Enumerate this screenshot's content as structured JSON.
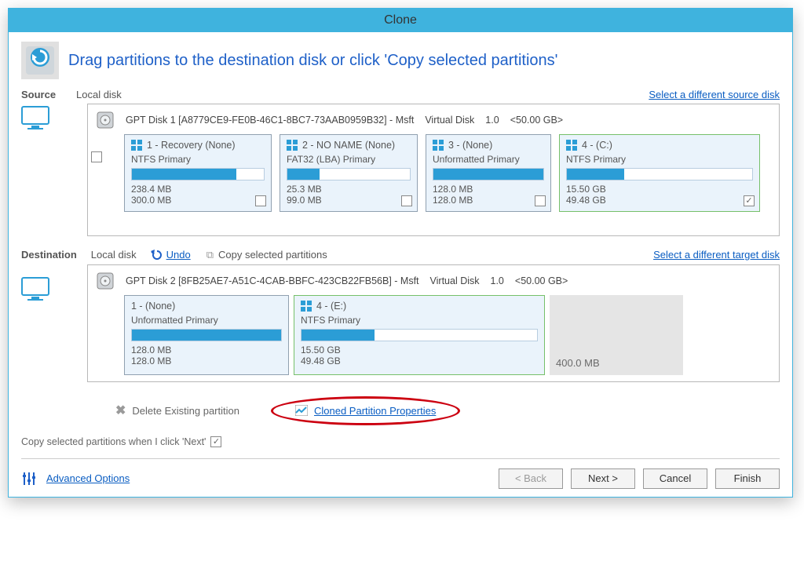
{
  "title": "Clone",
  "header": "Drag partitions to the destination disk or click 'Copy selected partitions'",
  "source": {
    "label": "Source",
    "disk_type": "Local disk",
    "different_link": "Select a different source disk",
    "disk_id": "GPT Disk 1 [A8779CE9-FE0B-46C1-8BC7-73AAB0959B32] - Msft",
    "disk_kind": "Virtual Disk",
    "disk_ver": "1.0",
    "disk_size": "<50.00 GB>",
    "partitions": [
      {
        "title": "1 - Recovery (None)",
        "sub": "NTFS Primary",
        "used": "238.4 MB",
        "total": "300.0 MB",
        "fill": 79,
        "checked": false,
        "sel": false
      },
      {
        "title": "2 - NO NAME (None)",
        "sub": "FAT32 (LBA) Primary",
        "used": "25.3 MB",
        "total": "99.0 MB",
        "fill": 26,
        "checked": false,
        "sel": false
      },
      {
        "title": "3 -  (None)",
        "sub": "Unformatted Primary",
        "used": "128.0 MB",
        "total": "128.0 MB",
        "fill": 100,
        "checked": false,
        "sel": false
      },
      {
        "title": "4 -  (C:)",
        "sub": "NTFS Primary",
        "used": "15.50 GB",
        "total": "49.48 GB",
        "fill": 31,
        "checked": true,
        "sel": true
      }
    ]
  },
  "dest": {
    "label": "Destination",
    "disk_type": "Local disk",
    "undo": "Undo",
    "copy_sel": "Copy selected partitions",
    "different_link": "Select a different target disk",
    "disk_id": "GPT Disk 2 [8FB25AE7-A51C-4CAB-BBFC-423CB22FB56B] - Msft",
    "disk_kind": "Virtual Disk",
    "disk_ver": "1.0",
    "disk_size": "<50.00 GB>",
    "partitions": [
      {
        "title": "1 -  (None)",
        "sub": "Unformatted Primary",
        "used": "128.0 MB",
        "total": "128.0 MB",
        "fill": 100,
        "sel": false
      },
      {
        "title": "4 -  (E:)",
        "sub": "NTFS Primary",
        "used": "15.50 GB",
        "total": "49.48 GB",
        "fill": 31,
        "sel": true
      }
    ],
    "free": "400.0 MB"
  },
  "actions": {
    "delete": "Delete Existing partition",
    "props": "Cloned Partition Properties",
    "copy_next": "Copy selected partitions when I click 'Next'"
  },
  "footer": {
    "advanced": "Advanced Options",
    "back": "< Back",
    "next": "Next >",
    "cancel": "Cancel",
    "finish": "Finish"
  }
}
